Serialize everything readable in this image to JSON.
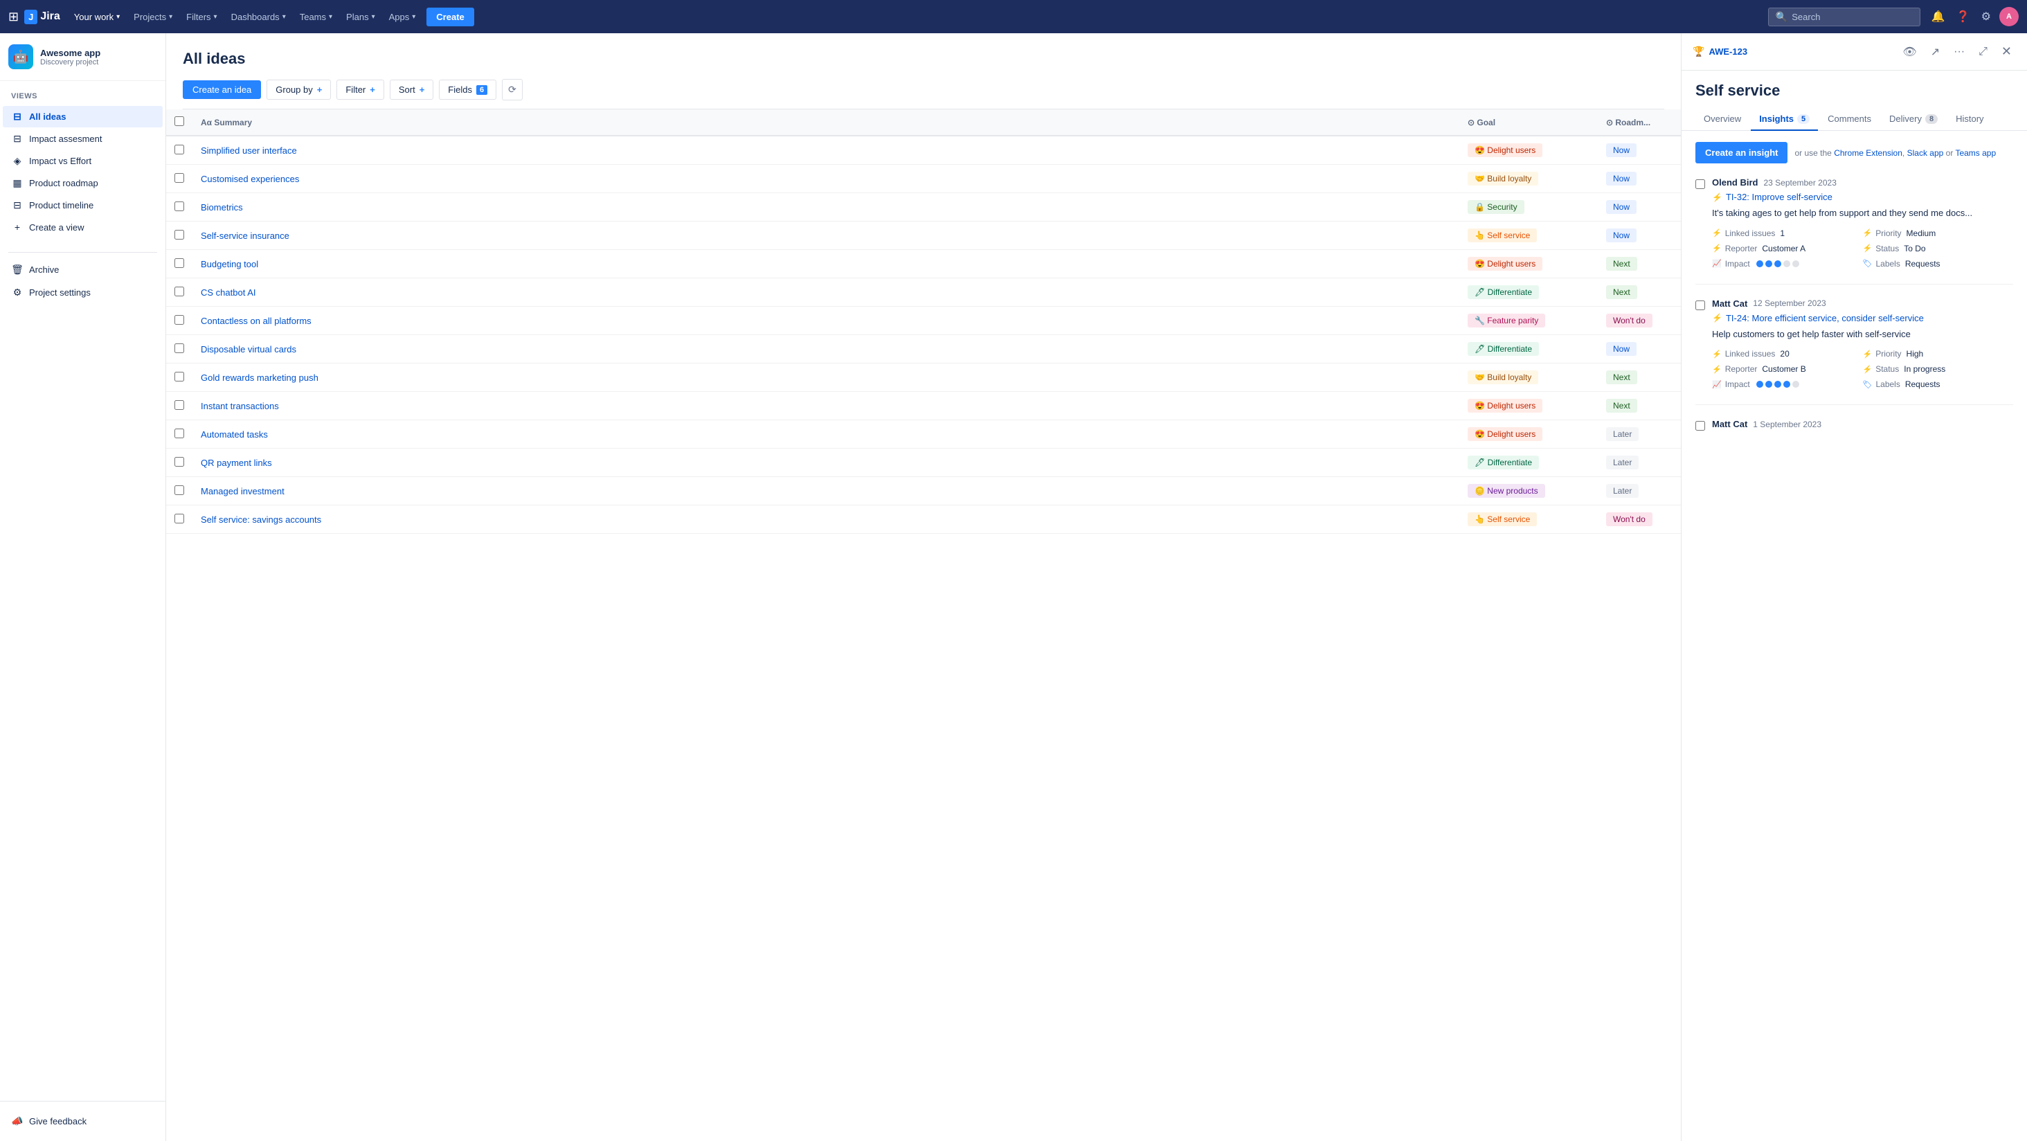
{
  "topnav": {
    "your_work": "Your work",
    "projects": "Projects",
    "filters": "Filters",
    "dashboards": "Dashboards",
    "teams": "Teams",
    "plans": "Plans",
    "apps": "Apps",
    "create": "Create",
    "search_placeholder": "Search"
  },
  "sidebar": {
    "project_name": "Awesome app",
    "project_type": "Discovery project",
    "views_label": "VIEWS",
    "items": [
      {
        "id": "all-ideas",
        "label": "All ideas",
        "icon": "≡",
        "active": true
      },
      {
        "id": "impact-assessment",
        "label": "Impact assesment",
        "icon": "≡"
      },
      {
        "id": "impact-vs-effort",
        "label": "Impact vs Effort",
        "icon": "⬢"
      },
      {
        "id": "product-roadmap",
        "label": "Product roadmap",
        "icon": "▦"
      },
      {
        "id": "product-timeline",
        "label": "Product timeline",
        "icon": "≡"
      },
      {
        "id": "create-view",
        "label": "Create a view",
        "icon": "+"
      }
    ],
    "archive": "Archive",
    "project_settings": "Project settings",
    "give_feedback": "Give feedback"
  },
  "main": {
    "title": "All ideas",
    "toolbar": {
      "create_idea": "Create an idea",
      "group_by": "Group by",
      "group_by_icon": "+",
      "filter": "Filter",
      "filter_icon": "+",
      "sort": "Sort",
      "sort_icon": "+",
      "fields": "Fields",
      "fields_count": "6"
    },
    "table": {
      "headers": [
        "",
        "Summary",
        "Goal",
        "Roadmap"
      ],
      "rows": [
        {
          "summary": "Simplified user interface",
          "goal": "Delight users",
          "goal_type": "delight",
          "goal_emoji": "😍",
          "roadmap": "Now",
          "roadmap_type": "now"
        },
        {
          "summary": "Customised experiences",
          "goal": "Build loyalty",
          "goal_type": "loyalty",
          "goal_emoji": "🤝",
          "roadmap": "Now",
          "roadmap_type": "now"
        },
        {
          "summary": "Biometrics",
          "goal": "Security",
          "goal_type": "security",
          "goal_emoji": "🔒",
          "roadmap": "Now",
          "roadmap_type": "now"
        },
        {
          "summary": "Self-service insurance",
          "goal": "Self service",
          "goal_type": "selfservice",
          "goal_emoji": "👆",
          "roadmap": "Now",
          "roadmap_type": "now"
        },
        {
          "summary": "Budgeting tool",
          "goal": "Delight users",
          "goal_type": "delight",
          "goal_emoji": "😍",
          "roadmap": "Next",
          "roadmap_type": "next"
        },
        {
          "summary": "CS chatbot AI",
          "goal": "Differentiate",
          "goal_type": "differentiate",
          "goal_emoji": "🖊",
          "roadmap": "Next",
          "roadmap_type": "next"
        },
        {
          "summary": "Contactless on all platforms",
          "goal": "Feature parity",
          "goal_type": "featureparity",
          "goal_emoji": "🔧",
          "roadmap": "Won't do",
          "roadmap_type": "wontdo"
        },
        {
          "summary": "Disposable virtual cards",
          "goal": "Differentiate",
          "goal_type": "differentiate",
          "goal_emoji": "🖊",
          "roadmap": "Now",
          "roadmap_type": "now"
        },
        {
          "summary": "Gold rewards marketing push",
          "goal": "Build loyalty",
          "goal_type": "loyalty",
          "goal_emoji": "🤝",
          "roadmap": "Next",
          "roadmap_type": "next"
        },
        {
          "summary": "Instant transactions",
          "goal": "Delight users",
          "goal_type": "delight",
          "goal_emoji": "😍",
          "roadmap": "Next",
          "roadmap_type": "next"
        },
        {
          "summary": "Automated tasks",
          "goal": "Delight users",
          "goal_type": "delight",
          "goal_emoji": "😍",
          "roadmap": "Later",
          "roadmap_type": "later"
        },
        {
          "summary": "QR payment links",
          "goal": "Differentiate",
          "goal_type": "differentiate",
          "goal_emoji": "🖊",
          "roadmap": "Later",
          "roadmap_type": "later"
        },
        {
          "summary": "Managed investment",
          "goal": "New products",
          "goal_type": "newproducts",
          "goal_emoji": "🪙",
          "roadmap": "Later",
          "roadmap_type": "later"
        },
        {
          "summary": "Self service: savings accounts",
          "goal": "Self service",
          "goal_type": "selfservice",
          "goal_emoji": "👆",
          "roadmap": "Won't do",
          "roadmap_type": "wontdo"
        }
      ]
    }
  },
  "panel": {
    "issue_key": "AWE-123",
    "title": "Self service",
    "tabs": [
      {
        "id": "overview",
        "label": "Overview",
        "active": false
      },
      {
        "id": "insights",
        "label": "Insights",
        "badge": "5",
        "active": true
      },
      {
        "id": "comments",
        "label": "Comments",
        "active": false
      },
      {
        "id": "delivery",
        "label": "Delivery",
        "badge": "8",
        "active": false
      },
      {
        "id": "history",
        "label": "History",
        "active": false
      }
    ],
    "create_insight": "Create an insight",
    "or_use_text": "or use the",
    "chrome_ext": "Chrome Extension",
    "comma1": ",",
    "slack_app": "Slack app",
    "or": "or",
    "teams_app": "Teams app",
    "insights": [
      {
        "author": "Olend Bird",
        "date": "23 September 2023",
        "link_text": "TI-32: Improve self-service",
        "description": "It's taking ages to get help from support and they send me docs...",
        "linked_issues": "1",
        "priority": "Medium",
        "reporter": "Customer A",
        "status": "To Do",
        "impact_dots": 3,
        "labels": "Requests"
      },
      {
        "author": "Matt Cat",
        "date": "12 September 2023",
        "link_text": "TI-24: More efficient service, consider self-service",
        "description": "Help customers to get help faster with self-service",
        "linked_issues": "20",
        "priority": "High",
        "reporter": "Customer B",
        "status": "In progress",
        "impact_dots": 4,
        "labels": "Requests"
      },
      {
        "author": "Matt Cat",
        "date": "1 September 2023",
        "link_text": "",
        "description": "",
        "linked_issues": "",
        "priority": "",
        "reporter": "",
        "status": "",
        "impact_dots": 0,
        "labels": ""
      }
    ]
  }
}
